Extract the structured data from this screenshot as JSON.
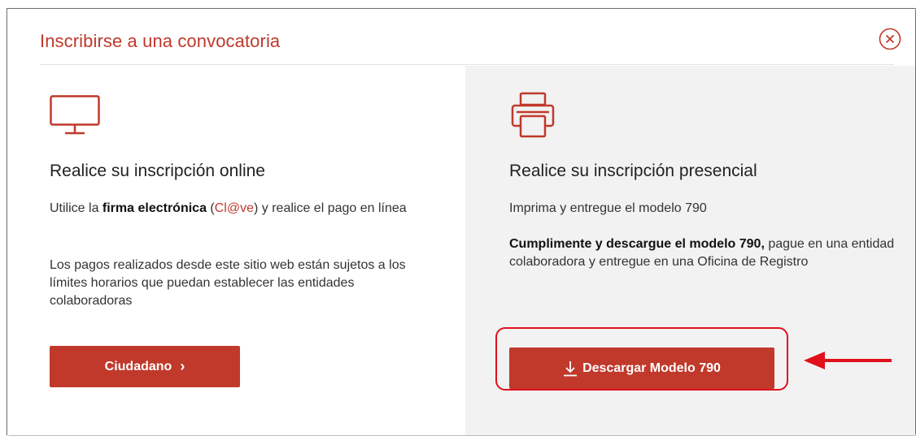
{
  "modal": {
    "title": "Inscribirse a una convocatoria"
  },
  "colors": {
    "accent": "#c0392b",
    "annotation": "#e0101c",
    "right_panel_bg": "#f2f2f2"
  },
  "online": {
    "icon": "monitor-icon",
    "heading": "Realice su inscripción online",
    "p1_pre": "Utilice la ",
    "p1_bold": "firma electrónica",
    "p1_paren_open": " (",
    "p1_link": "Cl@ve",
    "p1_post": ") y realice el pago en línea",
    "p2": "Los pagos realizados desde este sitio web están sujetos a los límites horarios que puedan establecer las entidades colaboradoras",
    "button_label": "Ciudadano",
    "button_chevron": "›"
  },
  "presencial": {
    "icon": "printer-icon",
    "heading": "Realice su inscripción presencial",
    "p1": "Imprima y entregue el modelo 790",
    "p2_bold": "Cumplimente y descargue el modelo 790,",
    "p2_rest": " pague en una entidad colaboradora y entregue en una Oficina de Registro",
    "button_label": "Descargar Modelo 790",
    "button_icon": "download-icon"
  }
}
